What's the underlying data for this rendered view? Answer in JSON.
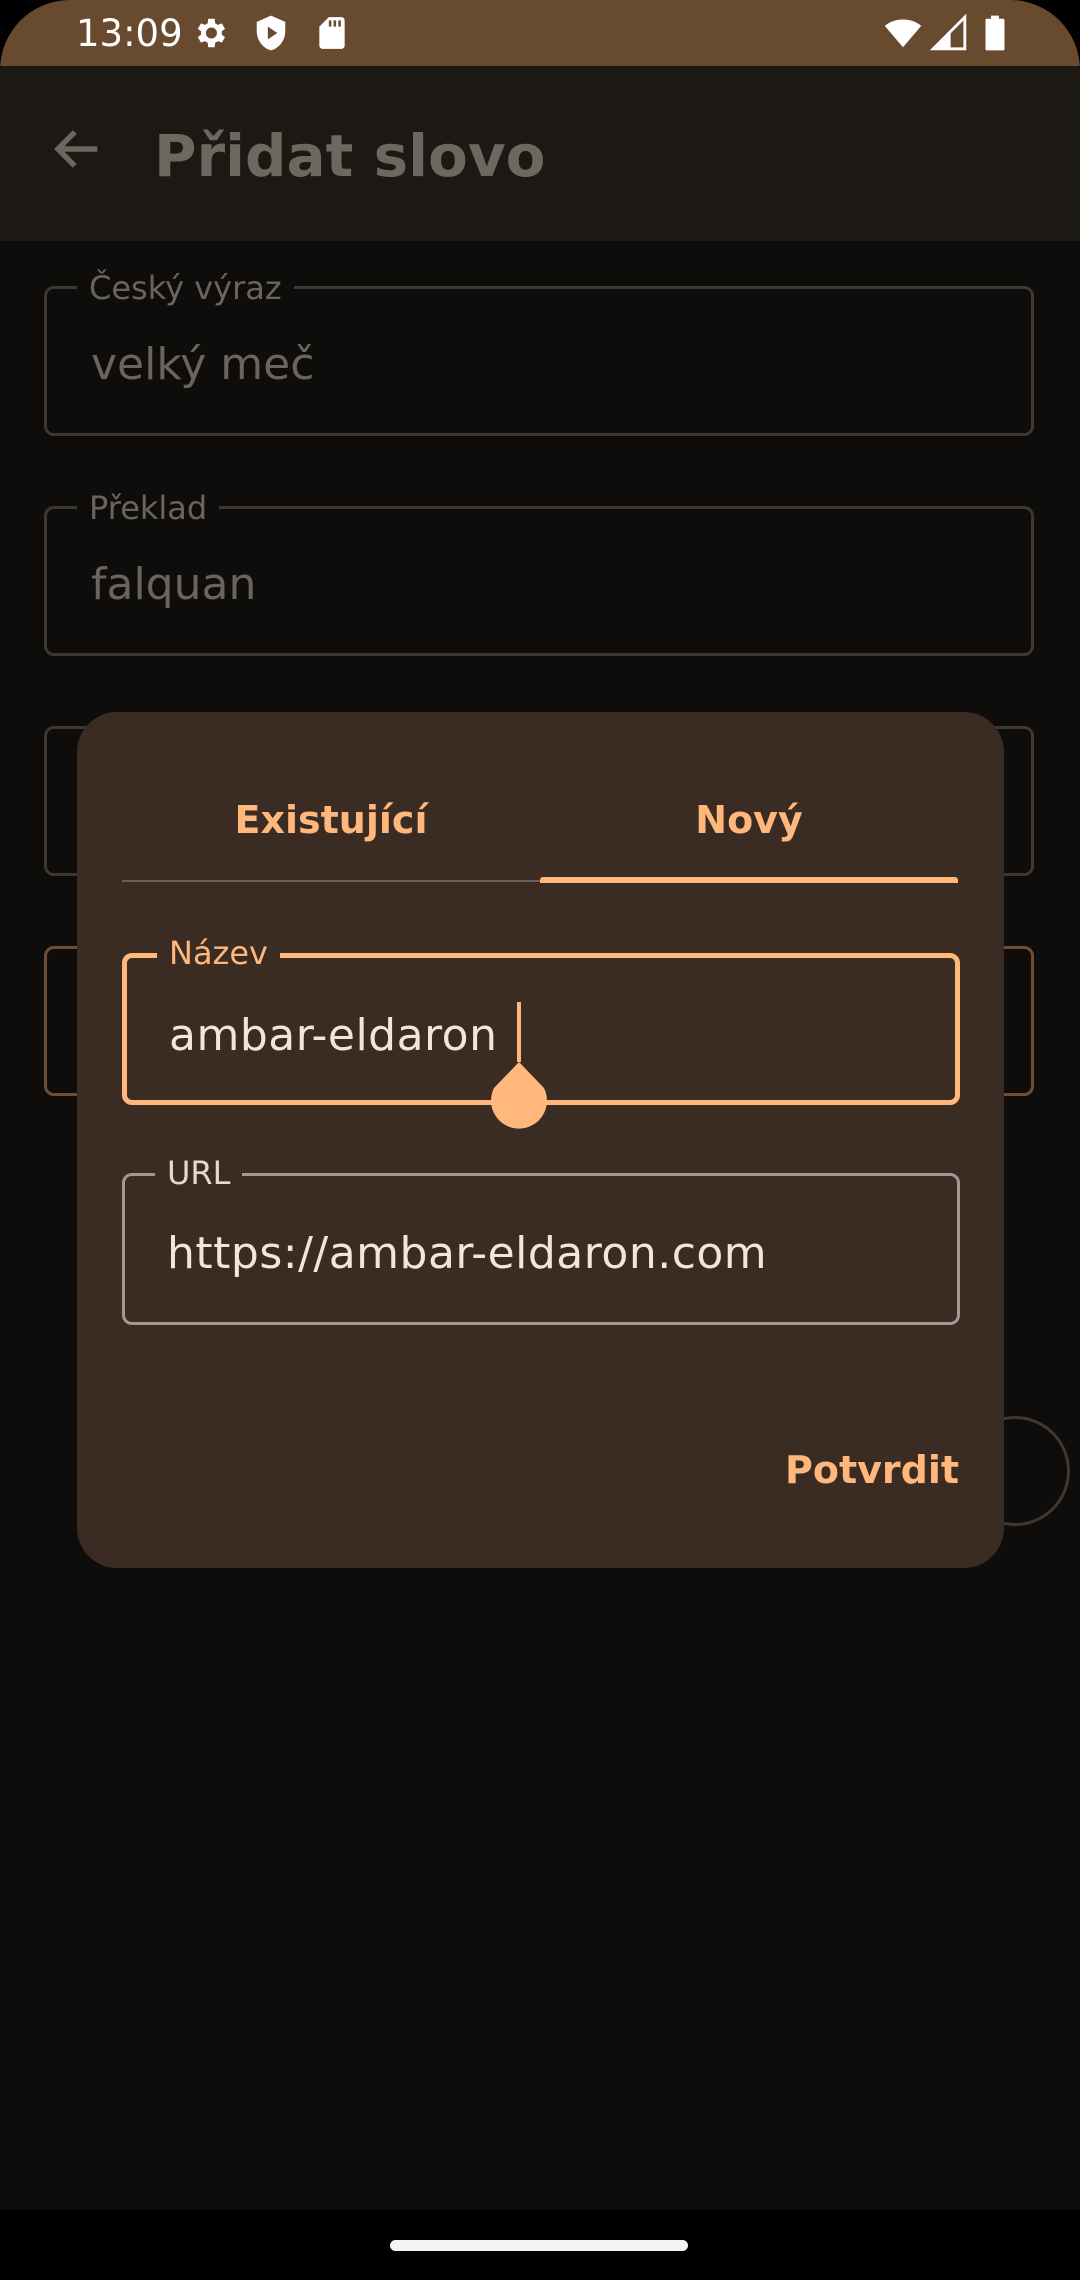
{
  "status_bar": {
    "time": "13:09",
    "left_icons": [
      "gear-icon",
      "shield-play-icon",
      "sd-card-icon"
    ],
    "right_icons": [
      "wifi-icon",
      "signal-icon",
      "battery-icon"
    ]
  },
  "app_bar": {
    "back_icon": "arrow-left-icon",
    "title": "Přidat slovo"
  },
  "form": {
    "czech_label": "Český výraz",
    "czech_value": "velký meč",
    "translation_label": "Překlad",
    "translation_value": "falquan"
  },
  "dialog": {
    "tabs": [
      {
        "label": "Existující",
        "selected": false
      },
      {
        "label": "Nový",
        "selected": true
      }
    ],
    "name_label": "Název",
    "name_value": "ambar-eldaron",
    "url_label": "URL",
    "url_value": "https://ambar-eldaron.com",
    "confirm_label": "Potvrdit"
  },
  "colors": {
    "accent": "#ffb77c",
    "status_bar": "#684a2f",
    "dialog_bg": "#3a2c23",
    "background": "#0f0d0b"
  }
}
